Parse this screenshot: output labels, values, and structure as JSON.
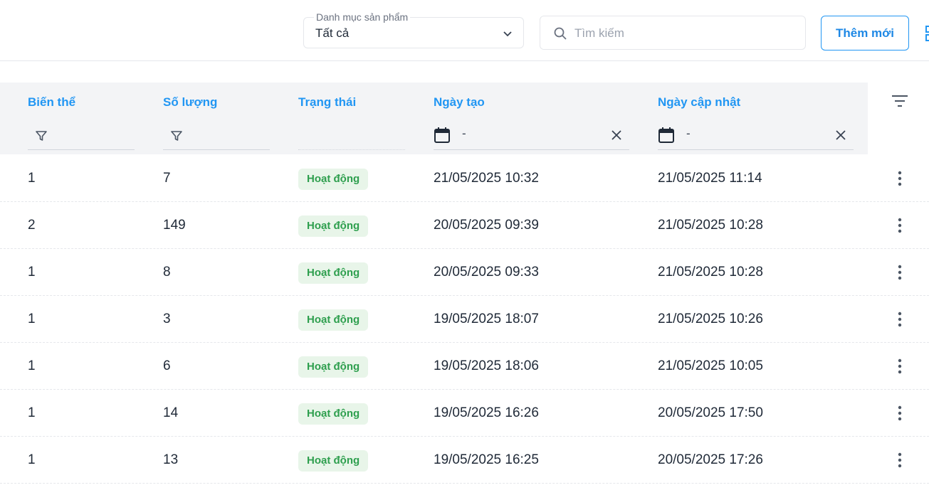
{
  "toolbar": {
    "category_label": "Danh mục sản phẩm",
    "category_value": "Tất cả",
    "search_placeholder": "Tìm kiếm",
    "add_label": "Thêm mới"
  },
  "table": {
    "headers": {
      "variant": "Biến thể",
      "quantity": "Số lượng",
      "status": "Trạng thái",
      "created": "Ngày tạo",
      "updated": "Ngày cập nhật"
    },
    "date_filter": {
      "created": "-",
      "updated": "-"
    },
    "rows": [
      {
        "variant": "1",
        "quantity": "7",
        "status": "Hoạt động",
        "created": "21/05/2025 10:32",
        "updated": "21/05/2025 11:14"
      },
      {
        "variant": "2",
        "quantity": "149",
        "status": "Hoạt động",
        "created": "20/05/2025 09:39",
        "updated": "21/05/2025 10:28"
      },
      {
        "variant": "1",
        "quantity": "8",
        "status": "Hoạt động",
        "created": "20/05/2025 09:33",
        "updated": "21/05/2025 10:28"
      },
      {
        "variant": "1",
        "quantity": "3",
        "status": "Hoạt động",
        "created": "19/05/2025 18:07",
        "updated": "21/05/2025 10:26"
      },
      {
        "variant": "1",
        "quantity": "6",
        "status": "Hoạt động",
        "created": "19/05/2025 18:06",
        "updated": "21/05/2025 10:05"
      },
      {
        "variant": "1",
        "quantity": "14",
        "status": "Hoạt động",
        "created": "19/05/2025 16:26",
        "updated": "20/05/2025 17:50"
      },
      {
        "variant": "1",
        "quantity": "13",
        "status": "Hoạt động",
        "created": "19/05/2025 16:25",
        "updated": "20/05/2025 17:26"
      }
    ]
  },
  "icons": {
    "chevron": "chevron-down-icon",
    "search": "search-icon",
    "funnel": "funnel-icon",
    "calendar": "calendar-icon",
    "clear": "close-icon",
    "columns_filter": "filter-list-icon",
    "row_menu": "more-vertical-icon"
  },
  "colors": {
    "accent": "#2196f3",
    "status_bg": "#e8f5e9",
    "status_text": "#2e9f4e"
  }
}
